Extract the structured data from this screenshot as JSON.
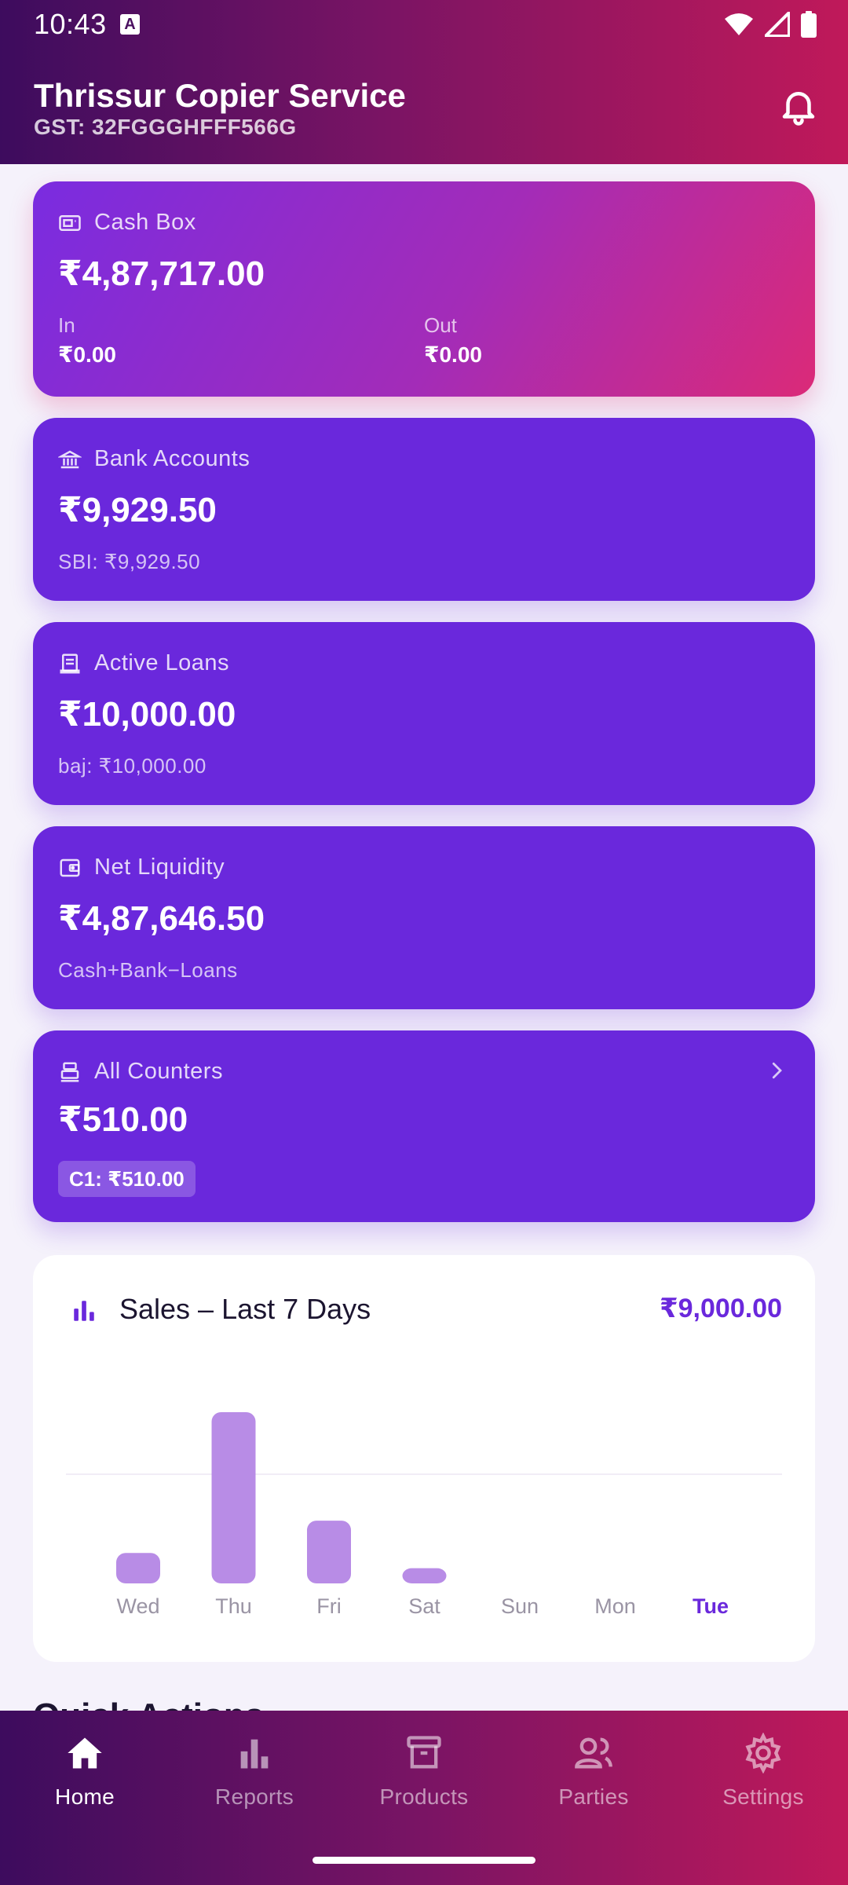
{
  "status_bar": {
    "time": "10:43",
    "notif_icon": "A"
  },
  "header": {
    "title": "Thrissur Copier Service",
    "subtitle": "GST: 32FGGGHFFF566G",
    "bell_icon": "bell-icon"
  },
  "cards": {
    "cash_box": {
      "label": "Cash Box",
      "amount": "₹4,87,717.00",
      "in_label": "In",
      "in_value": "₹0.00",
      "out_label": "Out",
      "out_value": "₹0.00"
    },
    "bank_accounts": {
      "label": "Bank Accounts",
      "amount": "₹9,929.50",
      "sub": "SBI: ₹9,929.50"
    },
    "active_loans": {
      "label": "Active Loans",
      "amount": "₹10,000.00",
      "sub": "baj: ₹10,000.00"
    },
    "net_liquidity": {
      "label": "Net Liquidity",
      "amount": "₹4,87,646.50",
      "sub": "Cash+Bank−Loans"
    },
    "all_counters": {
      "label": "All Counters",
      "amount": "₹510.00",
      "chip": "C1: ₹510.00"
    }
  },
  "sales": {
    "title": "Sales – Last 7 Days",
    "total": "₹9,000.00"
  },
  "chart_data": {
    "type": "bar",
    "title": "Sales – Last 7 Days",
    "categories": [
      "Wed",
      "Thu",
      "Fri",
      "Sat",
      "Sun",
      "Mon",
      "Tue"
    ],
    "values": [
      800,
      4500,
      1650,
      400,
      0,
      0,
      0
    ],
    "highlight": "Tue",
    "ylim": [
      0,
      4500
    ],
    "grid": false,
    "bar_color": "#b88ce6",
    "highlight_color": "#6a28dc"
  },
  "quick_actions": {
    "title": "Quick Actions"
  },
  "nav": {
    "items": [
      {
        "label": "Home",
        "icon": "home-icon"
      },
      {
        "label": "Reports",
        "icon": "bar-chart-icon"
      },
      {
        "label": "Products",
        "icon": "archive-box-icon"
      },
      {
        "label": "Parties",
        "icon": "users-icon"
      },
      {
        "label": "Settings",
        "icon": "gear-icon"
      }
    ],
    "active": "Home"
  },
  "colors": {
    "accent": "#6a28dc",
    "header_start": "#3d0c5e",
    "header_end": "#c0195a"
  }
}
